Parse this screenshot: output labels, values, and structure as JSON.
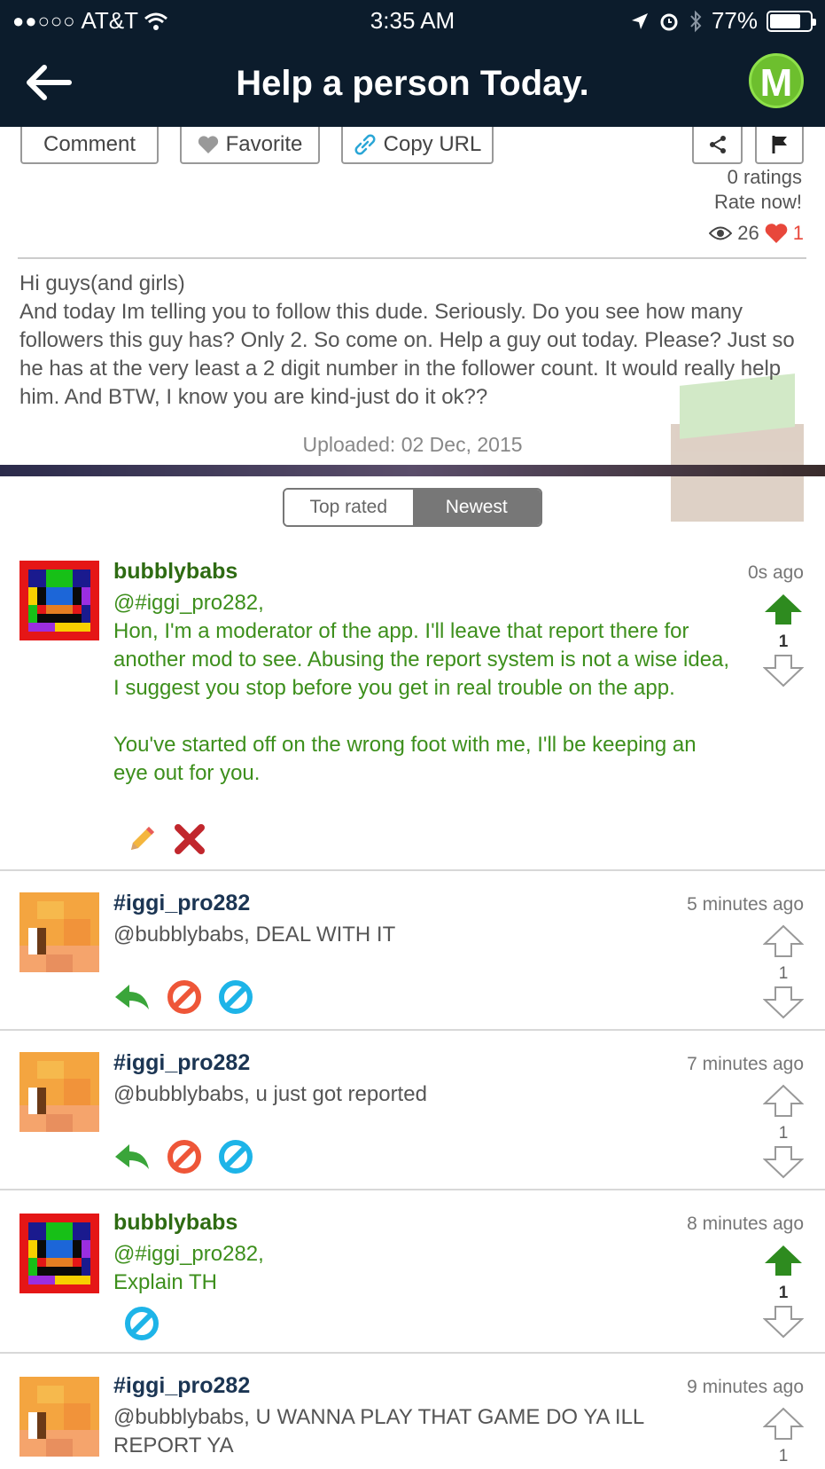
{
  "status_bar": {
    "carrier": "AT&T",
    "signal_dots": "●●○○○",
    "time": "3:35 AM",
    "battery": "77%",
    "battery_level": 0.77
  },
  "nav": {
    "title": "Help a person Today.",
    "logo_letter": "M"
  },
  "actions": {
    "comment": "Comment",
    "favorite": "Favorite",
    "copy_url": "Copy URL"
  },
  "post": {
    "ratings": "0 ratings",
    "rate_now": "Rate now!",
    "views": "26",
    "likes": "1",
    "body_line1": "Hi guys(and girls)",
    "body_text": "And today Im telling you to follow this dude. Seriously. Do you see how many followers this guy has? Only 2. So come on. Help a guy out today. Please? Just so he has at the very least a 2 digit number in the follower count. It would really help him. And BTW, I know you are kind-just do it ok??",
    "uploaded": "Uploaded: 02 Dec, 2015"
  },
  "sort": {
    "top_rated": "Top rated",
    "newest": "Newest"
  },
  "comments": [
    {
      "user": "bubblybabs",
      "time": "0s ago",
      "mention": "@#iggi_pro282,",
      "text": "Hon, I'm a moderator of the app. I'll leave that report there for another mod to see. Abusing the report system is not a wise idea, I suggest you stop before you get in real trouble on the app.",
      "text2": "You've started off on the wrong foot with me, I'll be keeping an eye out for you.",
      "votes": "1"
    },
    {
      "user": "#iggi_pro282",
      "time": "5 minutes ago",
      "text": "@bubblybabs, DEAL WITH IT",
      "votes": "1"
    },
    {
      "user": "#iggi_pro282",
      "time": "7 minutes ago",
      "text": "@bubblybabs, u just got reported",
      "votes": "1"
    },
    {
      "user": "bubblybabs",
      "time": "8 minutes ago",
      "mention": "@#iggi_pro282,",
      "text": "Explain TH",
      "votes": "1"
    },
    {
      "user": "#iggi_pro282",
      "time": "9 minutes ago",
      "text": "@bubblybabs, U WANNA PLAY THAT GAME DO YA ILL REPORT YA",
      "votes": "1"
    }
  ],
  "colors": {
    "nav_bg": "#0c1c2c",
    "mod_green": "#3d8f1c",
    "user_navy": "#1b3553",
    "accent_green": "#6dbf2e"
  }
}
